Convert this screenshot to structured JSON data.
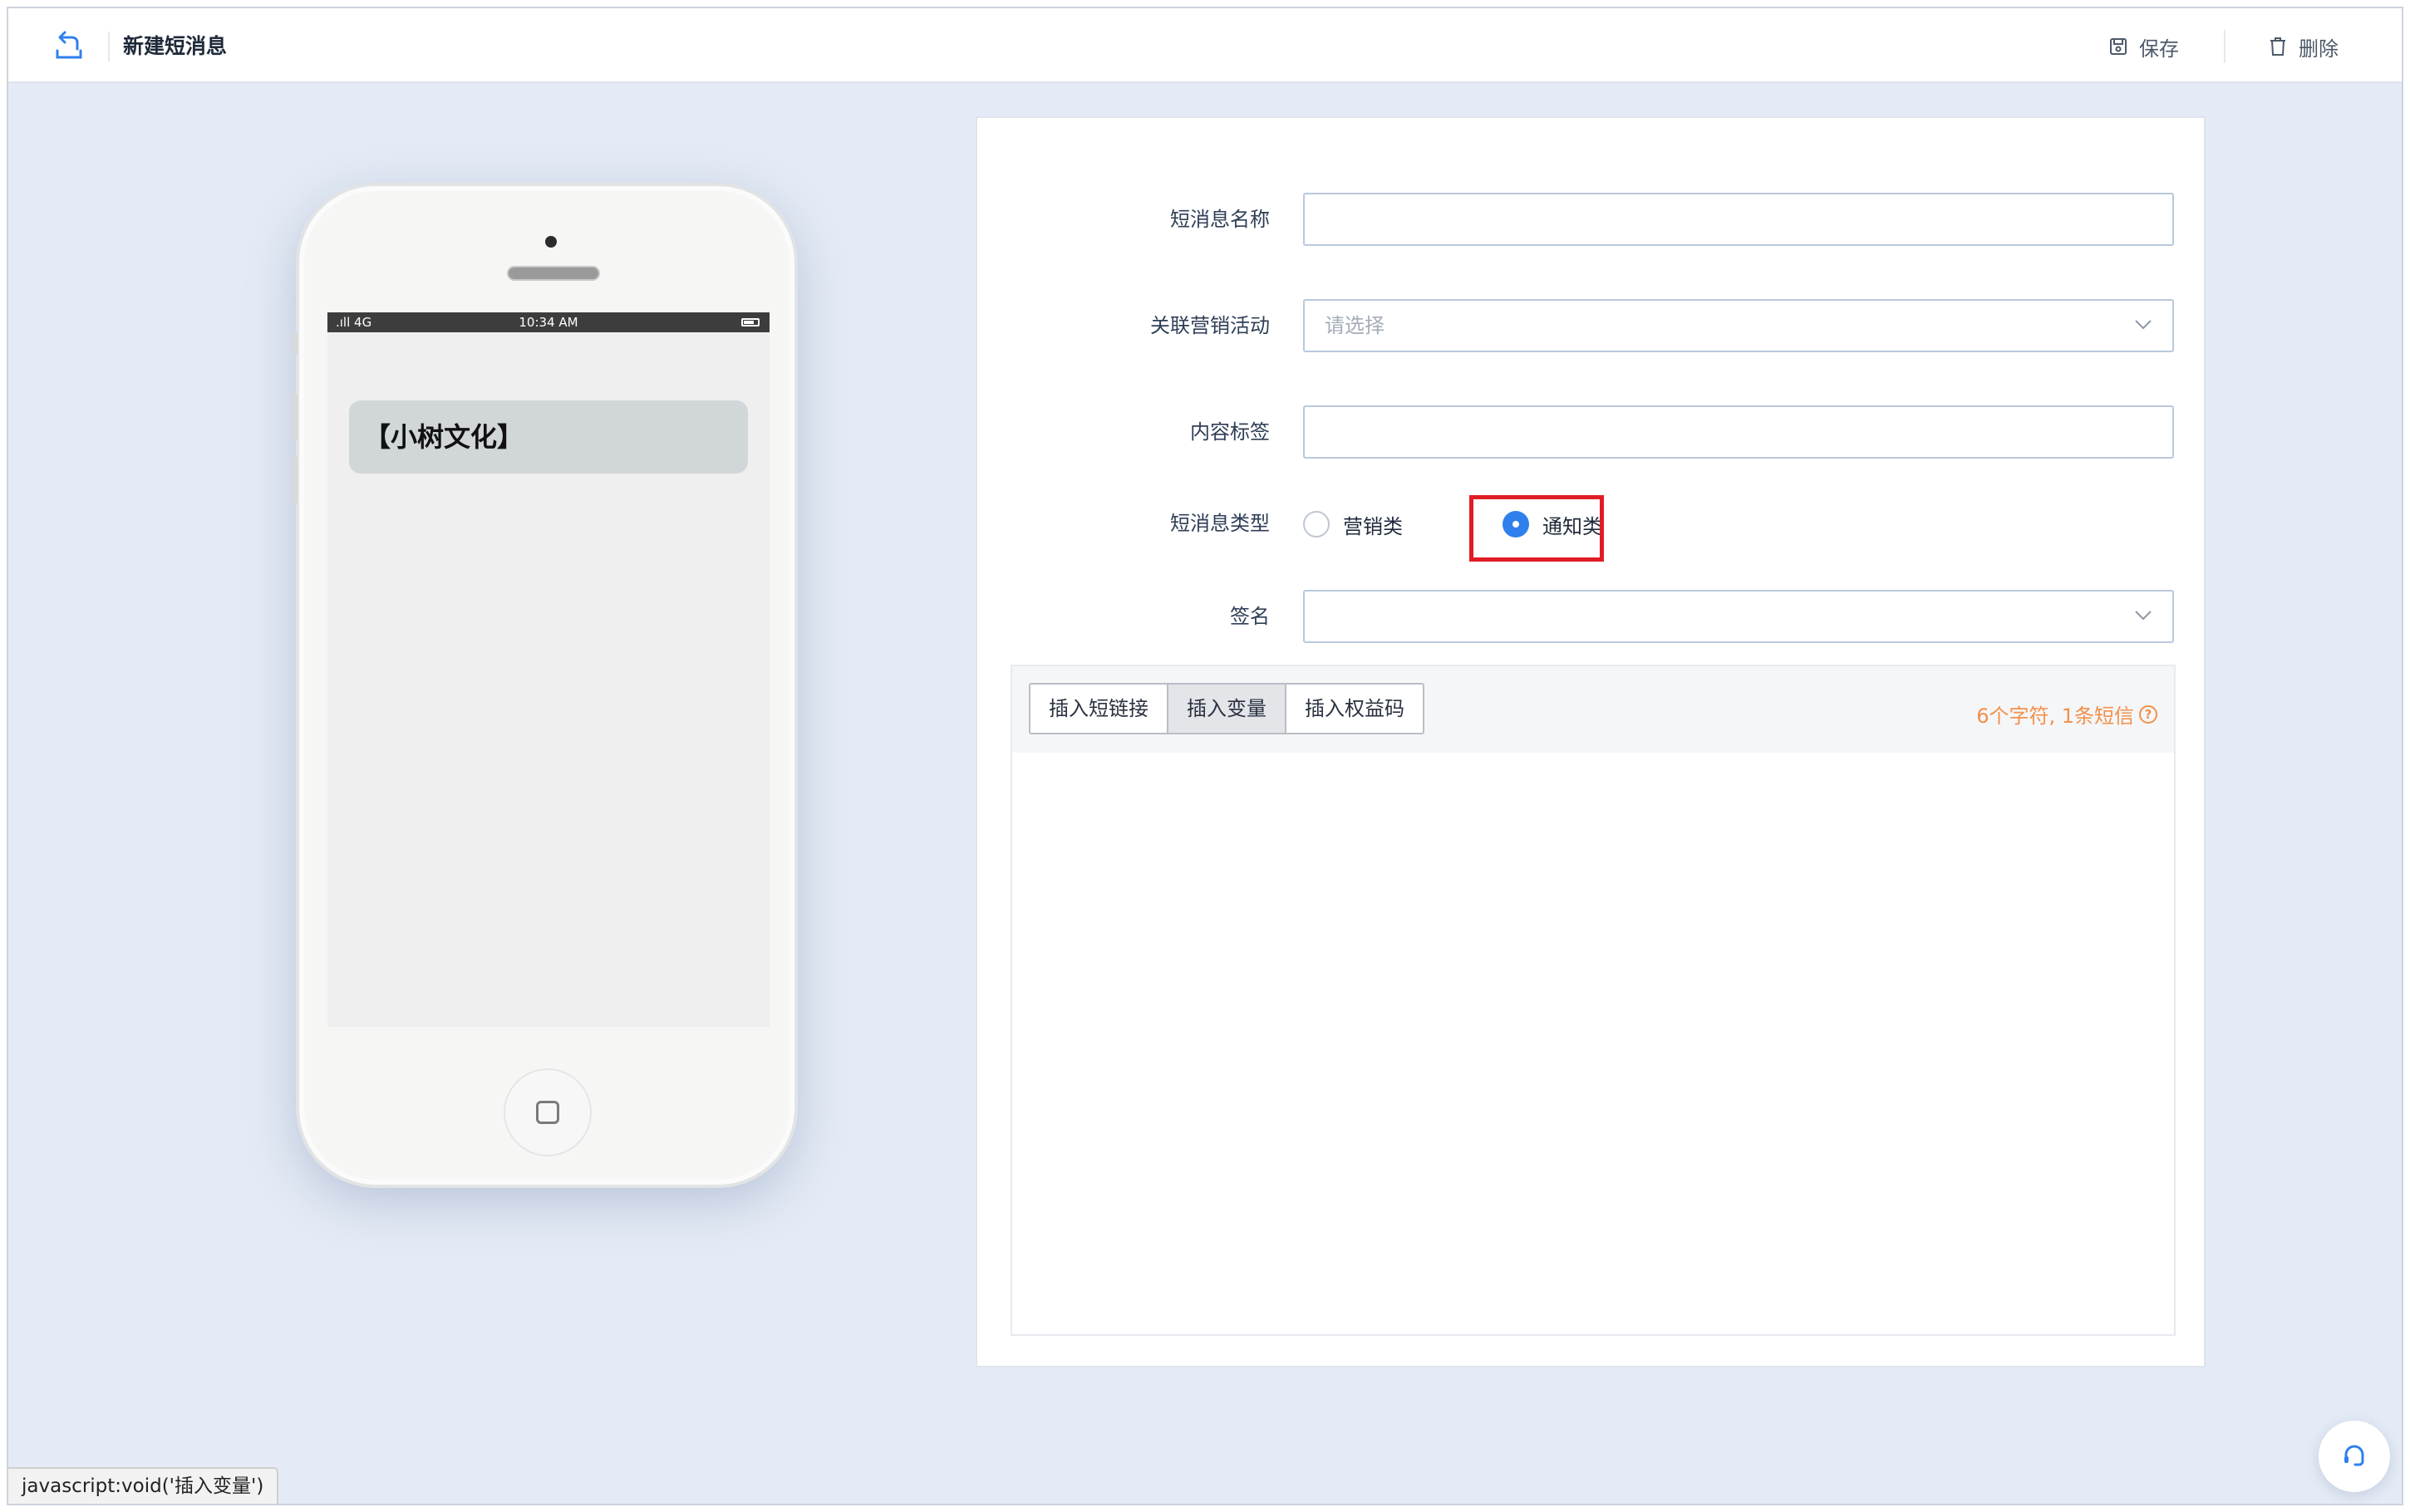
{
  "header": {
    "title": "新建短消息",
    "back_icon": "back-arrow-icon",
    "save_label": "保存",
    "delete_label": "删除"
  },
  "phone_preview": {
    "status_network": ".ıll 4G",
    "status_time": "10:34 AM",
    "message_text": "【小树文化】"
  },
  "form": {
    "name": {
      "label": "短消息名称",
      "value": ""
    },
    "campaign": {
      "label": "关联营销活动",
      "placeholder": "请选择"
    },
    "tag": {
      "label": "内容标签",
      "value": ""
    },
    "type": {
      "label": "短消息类型",
      "options": [
        "营销类",
        "通知类"
      ],
      "selected": "通知类"
    },
    "signature": {
      "label": "签名",
      "value": ""
    }
  },
  "editor": {
    "toolbar": [
      "插入短链接",
      "插入变量",
      "插入权益码"
    ],
    "active_tool": "插入变量",
    "char_count": "6个字符, 1条短信"
  },
  "status_url": "javascript:void('插入变量')",
  "colors": {
    "accent": "#2f80ed",
    "highlight": "#e01c25",
    "warning": "#f2904a",
    "background": "#e4ebf6"
  }
}
